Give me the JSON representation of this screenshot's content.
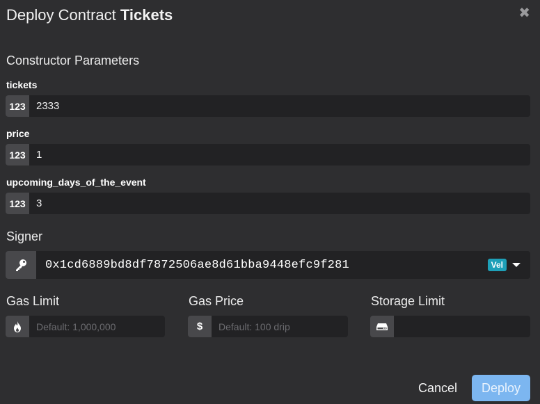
{
  "dialog": {
    "title_prefix": "Deploy Contract",
    "contract_name": "Tickets",
    "close_glyph": "✖"
  },
  "constructor": {
    "section_title": "Constructor Parameters",
    "params": [
      {
        "name": "tickets",
        "type_badge": "123",
        "value": "2333"
      },
      {
        "name": "price",
        "type_badge": "123",
        "value": "1"
      },
      {
        "name": "upcoming_days_of_the_event",
        "type_badge": "123",
        "value": "3"
      }
    ]
  },
  "signer": {
    "label": "Signer",
    "address": "0x1cd6889bd8df7872506ae8d61bba9448efc9f281",
    "network_badge": "Vel",
    "icon": "key-icon"
  },
  "gas": {
    "limit": {
      "label": "Gas Limit",
      "placeholder": "Default: 1,000,000",
      "icon": "flame-icon"
    },
    "price": {
      "label": "Gas Price",
      "placeholder": "Default: 100 drip",
      "icon": "dollar-icon"
    },
    "storage": {
      "label": "Storage Limit",
      "placeholder": "",
      "icon": "hard-drive-icon"
    }
  },
  "actions": {
    "cancel_label": "Cancel",
    "deploy_label": "Deploy"
  },
  "colors": {
    "background": "#2e2e30",
    "field": "#222224",
    "badge": "#48484b",
    "network_badge": "#1ea0b8",
    "deploy_button": "#7cb6f0"
  }
}
